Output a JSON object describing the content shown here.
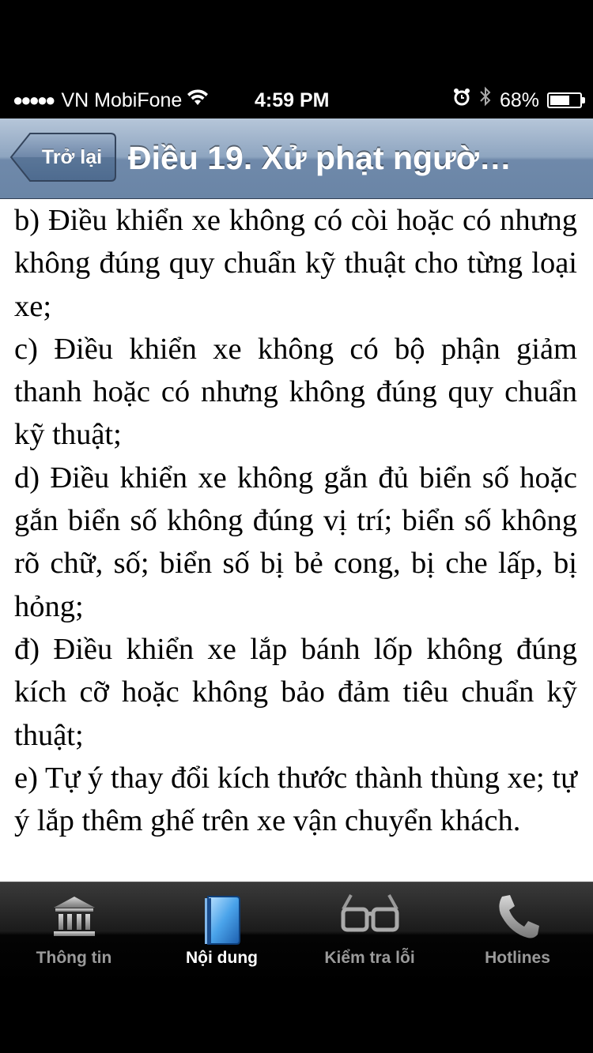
{
  "status_bar": {
    "signal_dots": "●●●●●",
    "carrier": "VN MobiFone",
    "time": "4:59 PM",
    "battery_percent": "68%",
    "battery_level": 0.68,
    "icons": [
      "wifi-icon",
      "alarm-icon",
      "bluetooth-icon",
      "battery-icon"
    ]
  },
  "nav": {
    "back_label": "Trở lại",
    "title": "Điều 19. Xử phạt ngườ…"
  },
  "content": {
    "paragraphs": [
      "b) Điều khiển xe không có còi hoặc có nhưng không đúng quy chuẩn kỹ thuật cho từng loại xe;",
      "c) Điều khiển xe không có bộ phận giảm thanh hoặc có nhưng không đúng quy chuẩn kỹ thuật;",
      "d) Điều khiển xe không gắn đủ biển số hoặc gắn biển số không đúng vị trí; biển số không rõ chữ, số; biển số bị bẻ cong, bị che lấp, bị hỏng;",
      "đ) Điều khiển xe lắp bánh lốp không đúng kích cỡ hoặc không bảo đảm tiêu chuẩn kỹ thuật;",
      "e) Tự ý thay đổi kích thước thành thùng xe; tự ý lắp thêm ghế trên xe vận chuyển khách."
    ]
  },
  "tabs": [
    {
      "label": "Thông tin",
      "icon": "building-columns-icon",
      "selected": false
    },
    {
      "label": "Nội dung",
      "icon": "book-icon",
      "selected": true
    },
    {
      "label": "Kiểm tra lỗi",
      "icon": "glasses-icon",
      "selected": false
    },
    {
      "label": "Hotlines",
      "icon": "phone-icon",
      "selected": false
    }
  ],
  "colors": {
    "nav_bar": "#8ea5c0",
    "tab_bar": "#1b1b1b",
    "tab_selected_icon": "#4a9be0"
  }
}
